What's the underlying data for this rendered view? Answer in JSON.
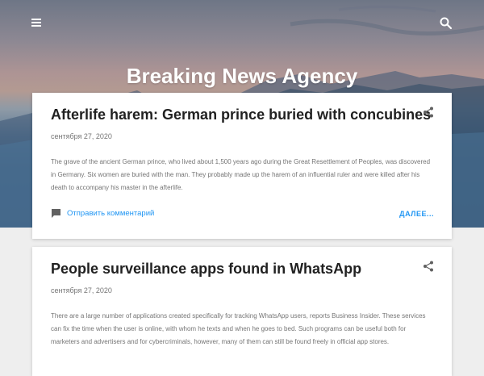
{
  "header": {
    "blog_title": "Breaking News Agency",
    "menu_icon": "hamburger-menu-icon",
    "search_icon": "search-icon"
  },
  "posts": [
    {
      "title": "Afterlife harem: German prince buried with concubines",
      "date": "сентября 27, 2020",
      "body": "The grave of the ancient German prince, who lived about 1,500 years ago during the Great Resettlement of Peoples, was discovered in Germany. Six women are buried with the man. They probably made up the harem of an influential ruler and were killed after his death to accompany his master in the afterlife.",
      "comment_label": "Отправить комментарий",
      "more_label": "ДАЛЕЕ..."
    },
    {
      "title": "People surveillance apps found in WhatsApp",
      "date": "сентября 27, 2020",
      "body": "There are a large number of applications created specifically for tracking WhatsApp users, reports Business Insider. These services can fix the time when the user is online, with whom he texts and when he goes to bed. Such programs can be useful both for marketers and advertisers and for cybercriminals, however, many of them can still be found freely in official app stores."
    }
  ],
  "colors": {
    "accent": "#2196f3",
    "title_text": "#212121",
    "body_text": "#757575",
    "page_bg": "#eeeeee"
  }
}
